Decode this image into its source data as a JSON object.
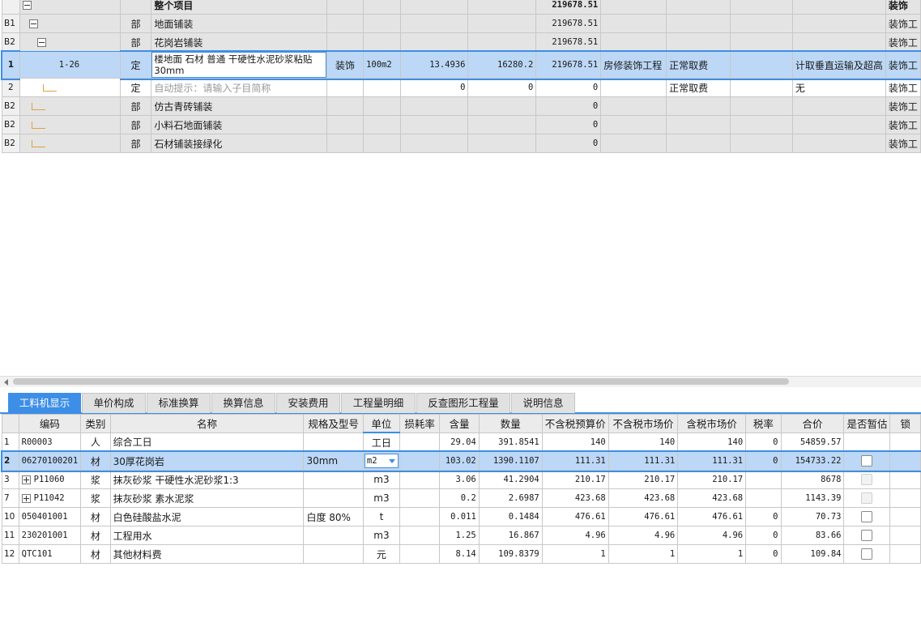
{
  "upper": {
    "header_row": {
      "name": "整个项目",
      "total": "219678.51",
      "spec": "装饰"
    },
    "rows": [
      {
        "no": "B1",
        "code": "",
        "type": "部",
        "name": "地面铺装",
        "total": "219678.51",
        "spec": "装饰工",
        "toggle": "minus",
        "level": 1
      },
      {
        "no": "B2",
        "code": "",
        "type": "部",
        "name": "花岗岩铺装",
        "total": "219678.51",
        "spec": "装饰工",
        "toggle": "minus",
        "level": 2
      },
      {
        "no": "1",
        "code": "1-26",
        "type": "定",
        "name": "楼地面 石材 普通 干硬性水泥砂浆粘贴30mm",
        "prof": "装饰",
        "unit": "100m2",
        "qty": "13.4936",
        "price": "16280.2",
        "total": "219678.51",
        "program": "房修装饰工程",
        "fee": "正常取费",
        "extra": "计取垂直运输及超高",
        "spec": "装饰工"
      },
      {
        "no": "2",
        "code": "",
        "type": "定",
        "name": "自动提示：请输入子目简称",
        "qty": "0",
        "price": "0",
        "total": "0",
        "fee": "正常取费",
        "extra": "无",
        "spec": "装饰工"
      },
      {
        "no": "B2",
        "code": "",
        "type": "部",
        "name": "仿古青砖铺装",
        "total": "0",
        "spec": "装饰工"
      },
      {
        "no": "B2",
        "code": "",
        "type": "部",
        "name": "小料石地面铺装",
        "total": "0",
        "spec": "装饰工"
      },
      {
        "no": "B2",
        "code": "",
        "type": "部",
        "name": "石材铺装接绿化",
        "total": "0",
        "spec": "装饰工"
      }
    ]
  },
  "tabs": [
    "工料机显示",
    "单价构成",
    "标准换算",
    "换算信息",
    "安装费用",
    "工程量明细",
    "反查图形工程量",
    "说明信息"
  ],
  "lower": {
    "columns": [
      "编码",
      "类别",
      "名称",
      "规格及型号",
      "单位",
      "损耗率",
      "含量",
      "数量",
      "不含税预算价",
      "不含税市场价",
      "含税市场价",
      "税率",
      "合价",
      "是否暂估",
      "锁"
    ],
    "rows": [
      {
        "no": "1",
        "code": "R00003",
        "cat": "人",
        "name": "综合工日",
        "spec": "",
        "unit": "工日",
        "loss": "",
        "content": "29.04",
        "qty": "391.8541",
        "budget": "140",
        "market": "140",
        "taxmarket": "140",
        "tax": "0",
        "total": "54859.57",
        "check": "none"
      },
      {
        "no": "2",
        "code": "06270100201",
        "cat": "材",
        "name": "30厚花岗岩",
        "spec": "30mm",
        "unit": "m2",
        "loss": "",
        "content": "103.02",
        "qty": "1390.1107",
        "budget": "111.31",
        "market": "111.31",
        "taxmarket": "111.31",
        "tax": "0",
        "total": "154733.22",
        "check": "box"
      },
      {
        "no": "3",
        "code": "P11060",
        "cat": "浆",
        "name": "抹灰砂浆 干硬性水泥砂浆1:3",
        "spec": "",
        "unit": "m3",
        "loss": "",
        "content": "3.06",
        "qty": "41.2904",
        "budget": "210.17",
        "market": "210.17",
        "taxmarket": "210.17",
        "tax": "",
        "total": "8678",
        "check": "disabled",
        "expand": true
      },
      {
        "no": "7",
        "code": "P11042",
        "cat": "浆",
        "name": "抹灰砂浆 素水泥浆",
        "spec": "",
        "unit": "m3",
        "loss": "",
        "content": "0.2",
        "qty": "2.6987",
        "budget": "423.68",
        "market": "423.68",
        "taxmarket": "423.68",
        "tax": "",
        "total": "1143.39",
        "check": "disabled",
        "expand": true
      },
      {
        "no": "10",
        "code": "050401001",
        "cat": "材",
        "name": "白色硅酸盐水泥",
        "spec": "白度 80%",
        "unit": "t",
        "loss": "",
        "content": "0.011",
        "qty": "0.1484",
        "budget": "476.61",
        "market": "476.61",
        "taxmarket": "476.61",
        "tax": "0",
        "total": "70.73",
        "check": "box"
      },
      {
        "no": "11",
        "code": "230201001",
        "cat": "材",
        "name": "工程用水",
        "spec": "",
        "unit": "m3",
        "loss": "",
        "content": "1.25",
        "qty": "16.867",
        "budget": "4.96",
        "market": "4.96",
        "taxmarket": "4.96",
        "tax": "0",
        "total": "83.66",
        "check": "box"
      },
      {
        "no": "12",
        "code": "QTC101",
        "cat": "材",
        "name": "其他材料费",
        "spec": "",
        "unit": "元",
        "loss": "",
        "content": "8.14",
        "qty": "109.8379",
        "budget": "1",
        "market": "1",
        "taxmarket": "1",
        "tax": "0",
        "total": "109.84",
        "check": "box"
      }
    ]
  }
}
